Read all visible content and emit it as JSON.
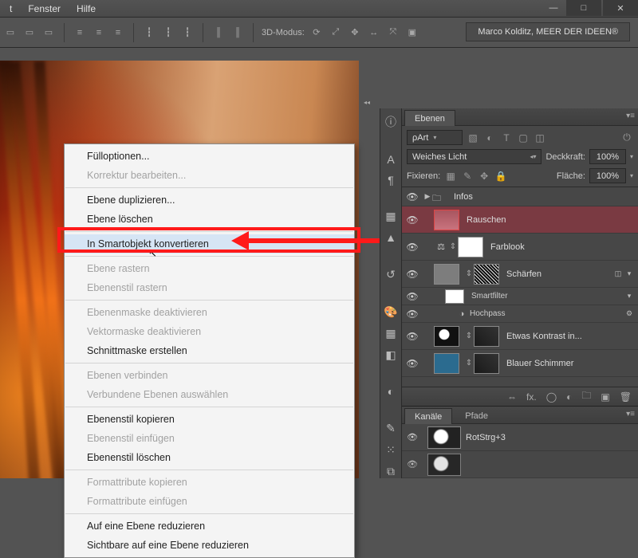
{
  "menubar": {
    "items": [
      "t",
      "Fenster",
      "Hilfe"
    ]
  },
  "window_buttons": {
    "min": "—",
    "max": "□",
    "close": "✕"
  },
  "optbar": {
    "mode_label": "3D-Modus:",
    "author": "Marco Kolditz, MEER DER IDEEN®"
  },
  "context_menu": {
    "groups": [
      [
        {
          "t": "Fülloptionen...",
          "d": false
        },
        {
          "t": "Korrektur bearbeiten...",
          "d": true
        }
      ],
      [
        {
          "t": "Ebene duplizieren...",
          "d": false
        },
        {
          "t": "Ebene löschen",
          "d": false
        }
      ],
      [
        {
          "t": "In Smartobjekt konvertieren",
          "d": false,
          "hl": true
        }
      ],
      [
        {
          "t": "Ebene rastern",
          "d": true
        },
        {
          "t": "Ebenenstil rastern",
          "d": true
        }
      ],
      [
        {
          "t": "Ebenenmaske deaktivieren",
          "d": true
        },
        {
          "t": "Vektormaske deaktivieren",
          "d": true
        },
        {
          "t": "Schnittmaske erstellen",
          "d": false
        }
      ],
      [
        {
          "t": "Ebenen verbinden",
          "d": true
        },
        {
          "t": "Verbundene Ebenen auswählen",
          "d": true
        }
      ],
      [
        {
          "t": "Ebenenstil kopieren",
          "d": false
        },
        {
          "t": "Ebenenstil einfügen",
          "d": true
        },
        {
          "t": "Ebenenstil löschen",
          "d": false
        }
      ],
      [
        {
          "t": "Formattribute kopieren",
          "d": true
        },
        {
          "t": "Formattribute einfügen",
          "d": true
        }
      ],
      [
        {
          "t": "Auf eine Ebene reduzieren",
          "d": false
        },
        {
          "t": "Sichtbare auf eine Ebene reduzieren",
          "d": false
        }
      ]
    ]
  },
  "layers_panel": {
    "tab": "Ebenen",
    "filter_label": "Art",
    "blend_mode": "Weiches Licht",
    "opacity_label": "Deckkraft:",
    "opacity": "100%",
    "lock_label": "Fixieren:",
    "fill_label": "Fläche:",
    "fill": "100%",
    "layers": [
      {
        "type": "group",
        "name": "Infos",
        "vis": true
      },
      {
        "type": "layer",
        "name": "Rauschen",
        "vis": true,
        "sel": true,
        "thumb": "pink"
      },
      {
        "type": "adj",
        "name": "Farblook",
        "vis": true,
        "thumb": "white",
        "icon": "balance"
      },
      {
        "type": "smart",
        "name": "Schärfen",
        "vis": true,
        "thumb": "grey",
        "mask": "noise",
        "fx": true
      },
      {
        "type": "sub",
        "name": "Smartfilter",
        "vis": true,
        "thumb": "white"
      },
      {
        "type": "sub2",
        "name": "Hochpass",
        "vis": true
      },
      {
        "type": "layer",
        "name": "Etwas Kontrast in...",
        "vis": true,
        "thumb": "photo",
        "mask": "dark"
      },
      {
        "type": "layer",
        "name": "Blauer Schimmer",
        "vis": true,
        "thumb": "dark",
        "mask": "dark",
        "tint": "#2b6b8f"
      }
    ]
  },
  "channels_panel": {
    "tabs": [
      "Kanäle",
      "Pfade"
    ],
    "rows": [
      {
        "name": "Rot",
        "shortcut": "Strg+3",
        "vis": true
      }
    ]
  }
}
